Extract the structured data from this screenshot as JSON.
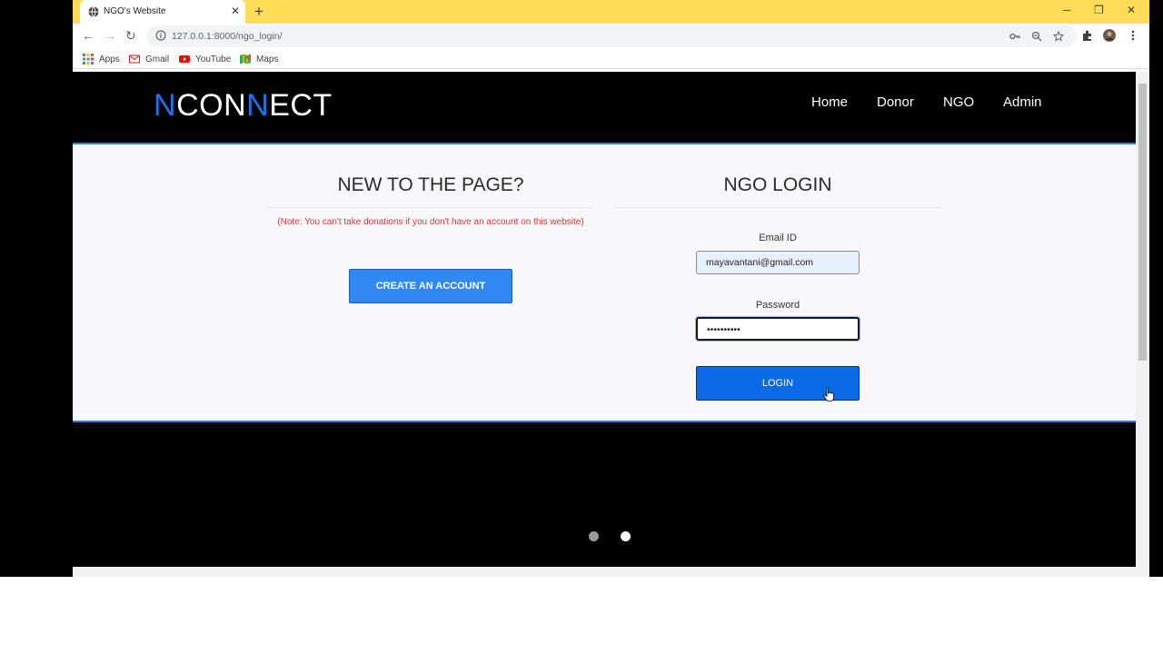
{
  "browser": {
    "tab_title": "NGO's Website",
    "url": "127.0.0.1:8000/ngo_login/",
    "bookmarks": [
      {
        "label": "Apps",
        "icon": "apps-grid-icon"
      },
      {
        "label": "Gmail",
        "icon": "gmail-icon"
      },
      {
        "label": "YouTube",
        "icon": "youtube-icon"
      },
      {
        "label": "Maps",
        "icon": "maps-icon"
      }
    ]
  },
  "site": {
    "logo_parts": [
      "N",
      "CON",
      "N",
      "ECT"
    ],
    "nav": [
      "Home",
      "Donor",
      "NGO",
      "Admin"
    ]
  },
  "signup": {
    "heading": "NEW TO THE PAGE?",
    "note": "(Note: You can't take donations if you don't have an account on this website)",
    "button": "CREATE AN ACCOUNT"
  },
  "login": {
    "heading": "NGO LOGIN",
    "email_label": "Email ID",
    "email_value": "mayavantani@gmail.com",
    "password_label": "Password",
    "password_value": "••••••••••",
    "button": "LOGIN"
  },
  "carousel": {
    "dots": 2,
    "active_index": 1
  },
  "colors": {
    "accent": "#1e73e8",
    "tabstrip": "#fddc57",
    "button": "#2f89f0",
    "note": "#d13b3b"
  }
}
